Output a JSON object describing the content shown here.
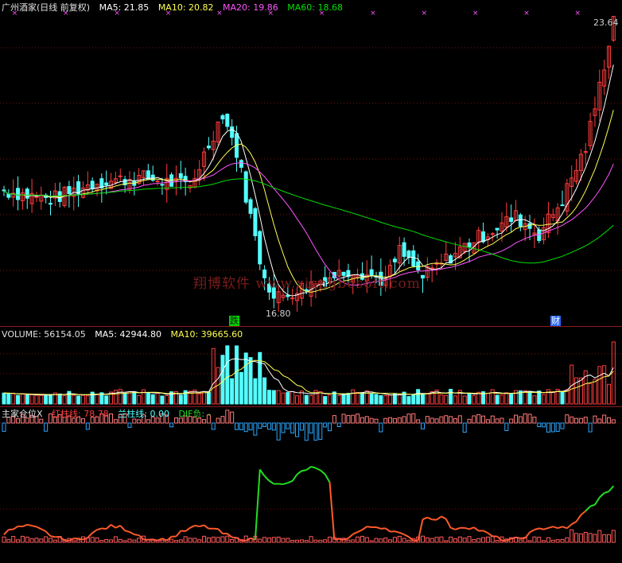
{
  "header": {
    "title": "广州酒家(日线 前复权)",
    "ma5": "MA5: 21.85",
    "ma10": "MA10: 20.82",
    "ma20": "MA20: 19.86",
    "ma60": "MA60: 18.68"
  },
  "volume_header": {
    "volume": "VOLUME: 56154.05",
    "ma5": "MA5: 42944.80",
    "ma10": "MA10: 39665.60"
  },
  "indicator_header": {
    "name": "主家仓位X",
    "red": "红柱线: 78.78",
    "blue": "兰柱线: 0.00",
    "dif": "DIF负: -"
  },
  "annotations": {
    "high_label": "23.64",
    "low_label": "16.80",
    "tag_left": "跌",
    "tag_right": "财",
    "watermark": "翔博软件 www.xiangbosoft.com"
  },
  "colors": {
    "up": "#ff3c3c",
    "down": "#54ffff",
    "ma5": "#ffffff",
    "ma10": "#ffff54",
    "ma20": "#ff54ff",
    "ma60": "#00e000",
    "dif_neg": "#2aa8ff",
    "indicator_red": "#ff5a2a",
    "indicator_green": "#22dd22",
    "grid": "#7a1010"
  },
  "chart_data": {
    "type": "candlestick",
    "price_range": [
      16.8,
      23.64
    ],
    "price_points": [
      {
        "i": 0,
        "close": 19.6
      },
      {
        "i": 10,
        "close": 19.4
      },
      {
        "i": 20,
        "close": 19.8
      },
      {
        "i": 30,
        "close": 19.9
      },
      {
        "i": 40,
        "close": 19.7
      },
      {
        "i": 47,
        "close": 21.4
      },
      {
        "i": 50,
        "close": 20.5
      },
      {
        "i": 55,
        "close": 18.0
      },
      {
        "i": 58,
        "close": 17.1
      },
      {
        "i": 65,
        "close": 17.4
      },
      {
        "i": 75,
        "close": 17.8
      },
      {
        "i": 82,
        "close": 17.5
      },
      {
        "i": 85,
        "close": 18.2
      },
      {
        "i": 90,
        "close": 17.6
      },
      {
        "i": 100,
        "close": 18.4
      },
      {
        "i": 110,
        "close": 19.0
      },
      {
        "i": 115,
        "close": 18.6
      },
      {
        "i": 120,
        "close": 19.4
      },
      {
        "i": 125,
        "close": 20.6
      },
      {
        "i": 128,
        "close": 22.0
      },
      {
        "i": 131,
        "close": 23.6
      }
    ],
    "volume_range": [
      0,
      56154.05
    ],
    "volume_last": 56154.05,
    "indicator_last": 78.78
  }
}
